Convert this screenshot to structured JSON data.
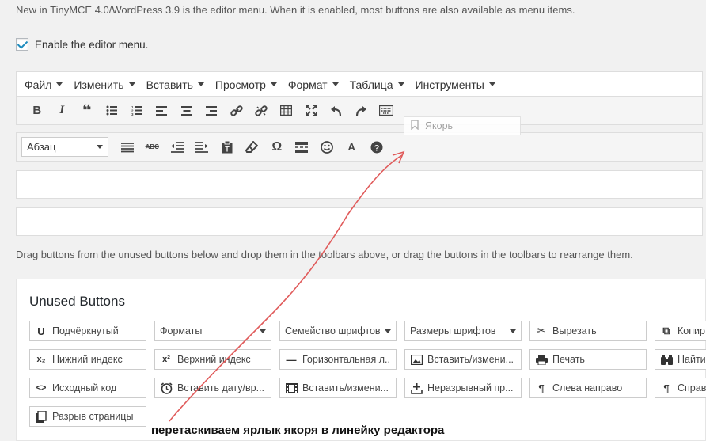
{
  "intro_text": "New in TinyMCE 4.0/WordPress 3.9 is the editor menu. When it is enabled, most buttons are also available as menu items.",
  "enable_label": "Enable the editor menu.",
  "menu": [
    "Файл",
    "Изменить",
    "Вставить",
    "Просмотр",
    "Формат",
    "Таблица",
    "Инструменты"
  ],
  "toolbar1_icons": [
    "bold-icon",
    "italic-icon",
    "blockquote-icon",
    "bullet-list-icon",
    "numbered-list-icon",
    "align-left-icon",
    "align-center-icon",
    "align-right-icon",
    "link-icon",
    "unlink-icon",
    "table-icon",
    "fullscreen-icon",
    "undo-icon",
    "redo-icon",
    "toolbar-toggle-icon"
  ],
  "toolbar2": {
    "format_select": "Абзац",
    "icons": [
      "horizontal-rule-icon",
      "strikethrough-icon",
      "outdent-icon",
      "indent-icon",
      "paste-text-icon",
      "clear-formatting-icon",
      "special-character-icon",
      "page-break-icon",
      "emoticons-icon",
      "text-color-icon",
      "help-icon"
    ]
  },
  "drag_ghost": {
    "icon": "bookmark-icon",
    "label": "Якорь"
  },
  "hint_text": "Drag buttons from the unused buttons below and drop them in the toolbars above, or drag the buttons in the toolbars to rearrange them.",
  "unused": {
    "title": "Unused Buttons",
    "rows": [
      [
        {
          "icon": "U",
          "label": "Подчёркнутый"
        },
        {
          "label": "Форматы",
          "select": true
        },
        {
          "label": "Семейство шрифтов",
          "select": true
        },
        {
          "label": "Размеры шрифтов",
          "select": true
        },
        {
          "icon": "✂",
          "label": "Вырезать"
        },
        {
          "icon": "⧉",
          "label": "Копир"
        }
      ],
      [
        {
          "icon": "x₂",
          "label": "Нижний индекс"
        },
        {
          "icon": "x²",
          "label": "Верхний индекс"
        },
        {
          "icon": "—",
          "label": "Горизонтальная л..."
        },
        {
          "icon": "▣",
          "label": "Вставить/измени..."
        },
        {
          "icon": "⎙",
          "label": "Печать"
        },
        {
          "icon": "🔭",
          "label": "Найти"
        }
      ],
      [
        {
          "icon": "<>",
          "label": "Исходный код"
        },
        {
          "icon": "⏰",
          "label": "Вставить дату/вр..."
        },
        {
          "icon": "▶",
          "label": "Вставить/измени..."
        },
        {
          "icon": "+",
          "label": "Неразрывный пр..."
        },
        {
          "icon": "¶",
          "label": "Слева направо"
        },
        {
          "icon": "¶",
          "label": "Справ"
        }
      ],
      [
        {
          "icon": "▤",
          "label": "Разрыв страницы"
        }
      ]
    ]
  },
  "annotation": "перетаскиваем ярлык якоря в линейку редактора",
  "colors": {
    "accent_check": "#1e8cbe",
    "annotation_arrow": "#e05a5a"
  }
}
